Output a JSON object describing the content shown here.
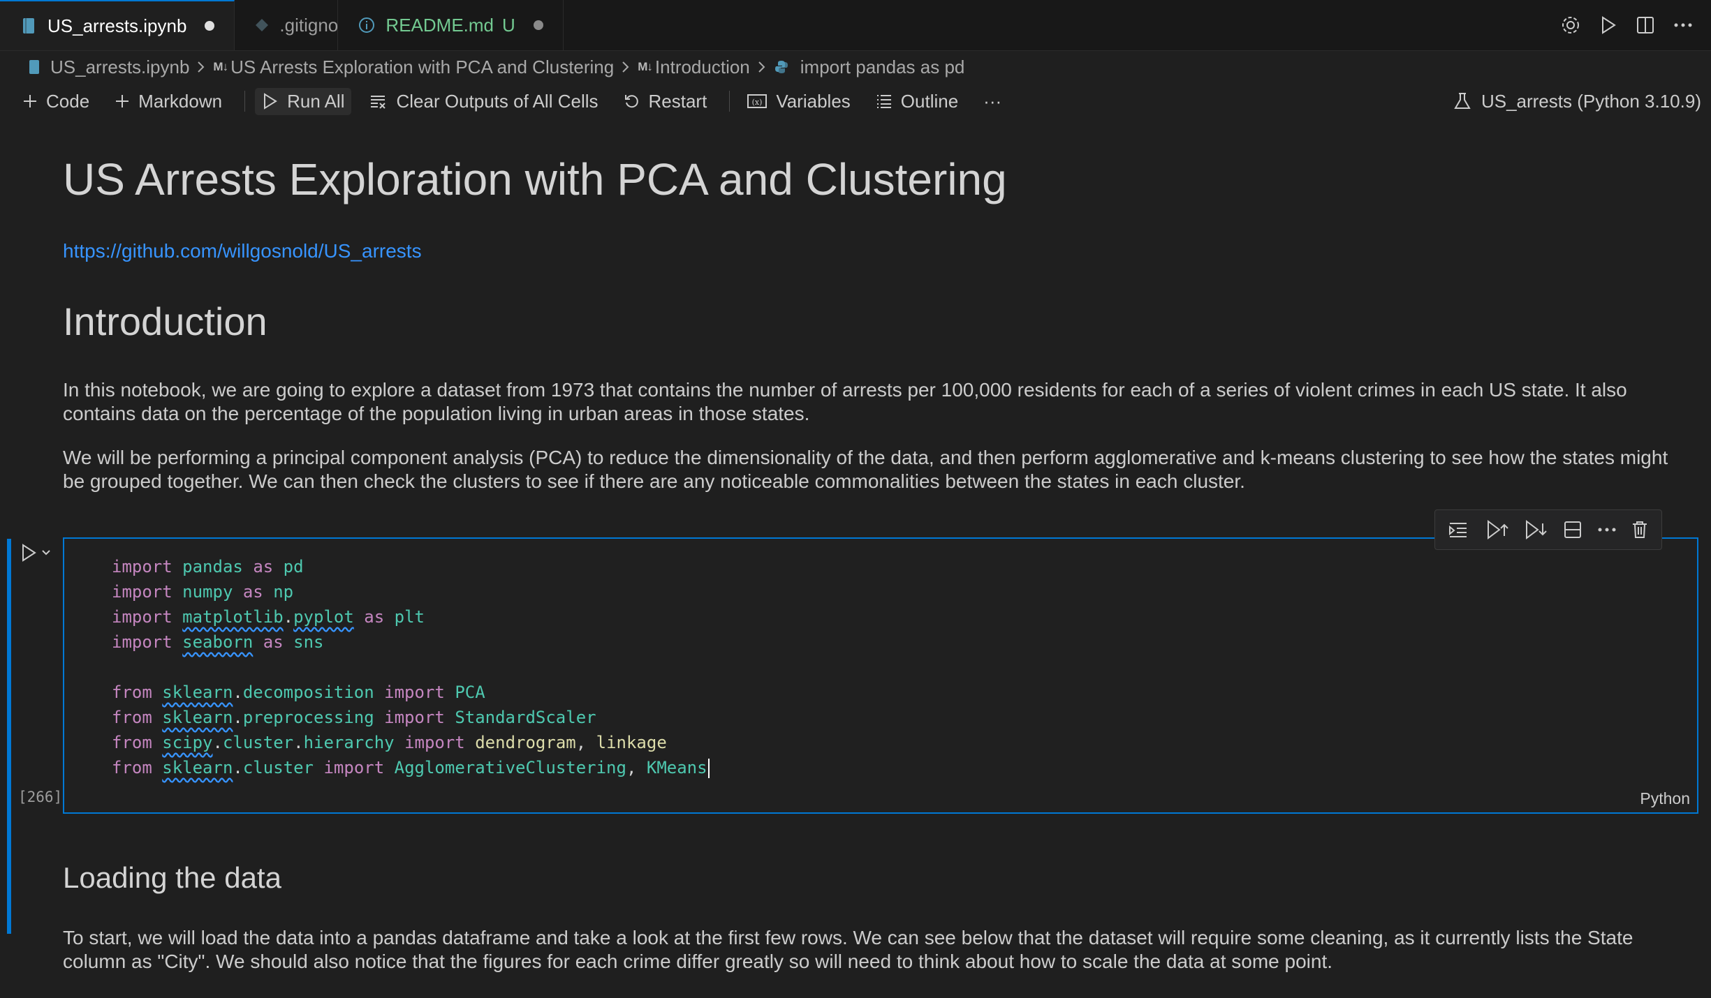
{
  "tabs": [
    {
      "label": "US_arrests.ipynb",
      "status": "●"
    },
    {
      "label": ".gitignore",
      "status": ""
    },
    {
      "label": "README.md",
      "badge": "U",
      "status": "●"
    }
  ],
  "breadcrumb": {
    "file": "US_arrests.ipynb",
    "md_marker": "M↓",
    "section1": "US Arrests Exploration with PCA and Clustering",
    "section2": "Introduction",
    "cell": "import pandas as pd"
  },
  "toolbar": {
    "code": "Code",
    "markdown": "Markdown",
    "run_all": "Run All",
    "clear": "Clear Outputs of All Cells",
    "restart": "Restart",
    "variables": "Variables",
    "outline": "Outline",
    "more": "···",
    "kernel": "US_arrests (Python 3.10.9)"
  },
  "notebook": {
    "title": "US Arrests Exploration with PCA and Clustering",
    "link": "https://github.com/willgosnold/US_arrests",
    "intro_heading": "Introduction",
    "intro_p1": "In this notebook, we are going to explore a dataset from 1973 that contains the number of arrests per 100,000 residents for each of a series of violent crimes in each US state. It also contains data on the percentage of the population living in urban areas in those states.",
    "intro_p2": "We will be performing a principal component analysis (PCA) to reduce the dimensionality of the data, and then perform agglomerative and k-means clustering to see how the states might be grouped together. We can then check the clusters to see if there are any noticeable commonalities between the states in each cluster.",
    "cell": {
      "execution_count": "[266]",
      "language": "Python"
    },
    "loading_heading": "Loading the data",
    "loading_p": "To start, we will load the data into a pandas dataframe and take a look at the first few rows. We can see below that the dataset will require some cleaning, as it currently lists the State column as \"City\". We should also notice that the figures for each crime differ greatly so will need to think about how to scale the data at some point."
  },
  "colors": {
    "accent": "#0078d4",
    "link": "#3794ff",
    "keyword": "#c586c0",
    "module": "#4ec9b0",
    "function": "#dcdcaa",
    "untracked": "#73c991"
  }
}
